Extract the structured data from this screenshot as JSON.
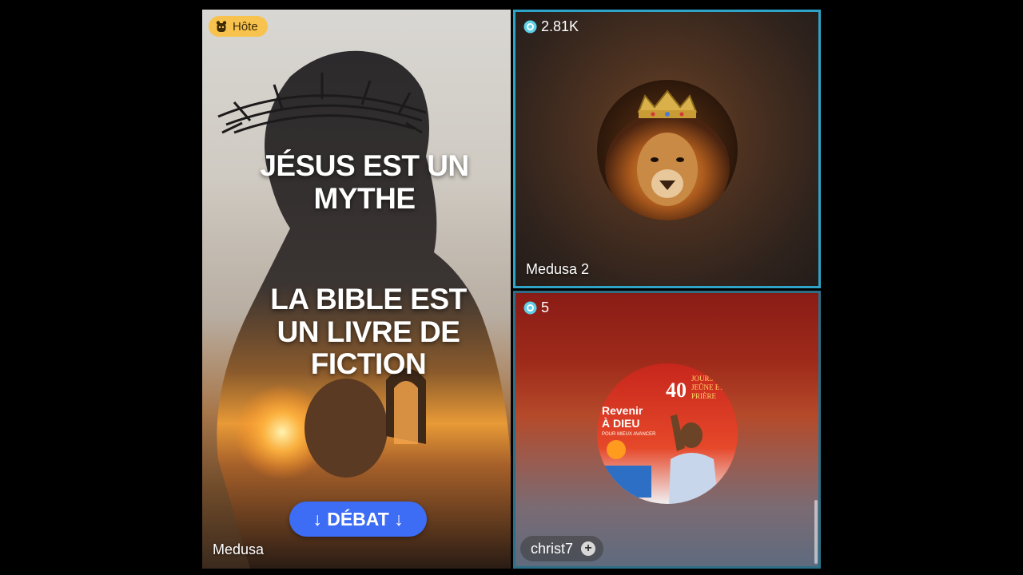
{
  "host": {
    "badge_label": "Hôte",
    "badge_icon": "host-icon",
    "headline_1": "JÉSUS EST UN MYTHE",
    "headline_2": "LA BIBLE EST UN LIVRE DE FICTION",
    "debate_button": "↓ DÉBAT ↓",
    "name": "Medusa"
  },
  "guests": [
    {
      "count": "2.81K",
      "name": "Medusa 2",
      "avatar": "crowned-lion-avatar"
    },
    {
      "count": "5",
      "name": "christ7",
      "avatar": "prayer-event-poster-avatar",
      "poster": {
        "number": "40",
        "line1": "JOURS DE",
        "line2": "JEÛNE ET",
        "line3": "PRIÈRE",
        "title1": "Revenir",
        "title2": "À DIEU",
        "subtitle": "POUR MIEUX AVANCER"
      }
    }
  ],
  "colors": {
    "active_border": "#2ea5c8",
    "host_badge": "#f7c34e",
    "debate_button": "#3d6cf5"
  }
}
